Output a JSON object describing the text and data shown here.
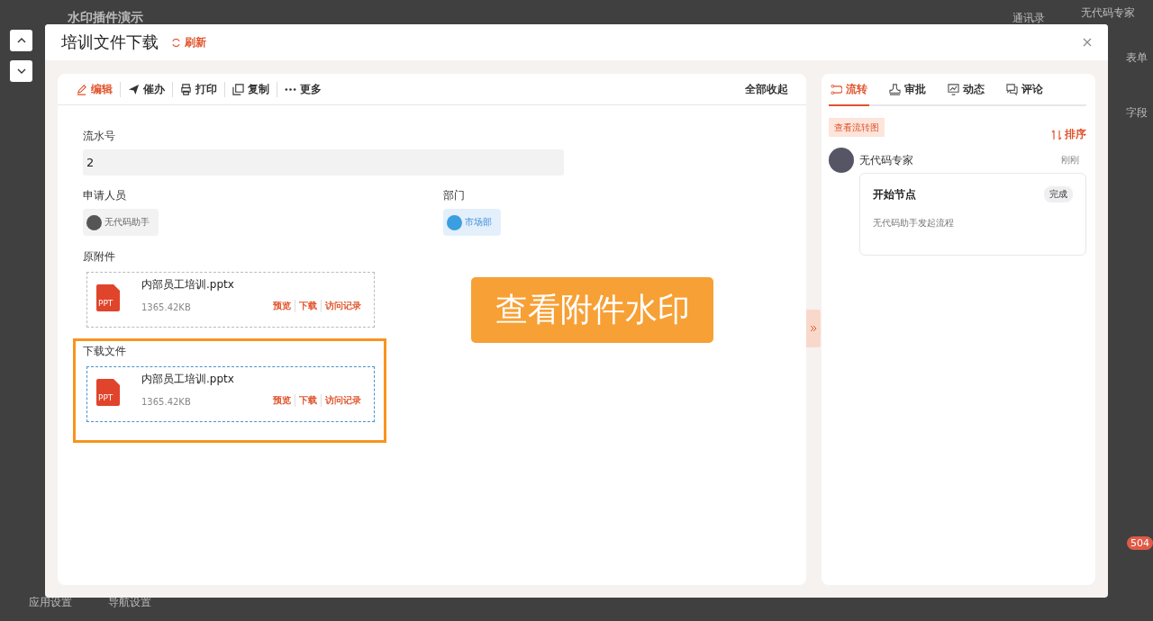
{
  "background": {
    "app_title": "水印插件演示",
    "header_link": "通讯录",
    "user_name": "无代码专家",
    "edge_labels": [
      "表单",
      "字段"
    ],
    "footer_links": [
      "应用设置",
      "导航设置"
    ],
    "badge": "504"
  },
  "modal": {
    "title": "培训文件下载",
    "refresh": "刷新",
    "toolbar": [
      {
        "label": "编辑",
        "kind": "edit"
      },
      {
        "label": "催办",
        "kind": "remind"
      },
      {
        "label": "打印",
        "kind": "print"
      },
      {
        "label": "复制",
        "kind": "copy"
      },
      {
        "label": "更多",
        "kind": "more"
      }
    ],
    "collapse_all": "全部收起",
    "serial": {
      "label": "流水号",
      "value": "2"
    },
    "applicant": {
      "label": "申请人员",
      "name": "无代码助手"
    },
    "department": {
      "label": "部门",
      "name": "市场部"
    },
    "attachments": [
      {
        "label": "原附件",
        "highlighted": false,
        "file": {
          "name": "内部员工培训.pptx",
          "type": "PPT",
          "size": "1365.42KB",
          "actions": [
            "预览",
            "下载",
            "访问记录"
          ]
        }
      },
      {
        "label": "下载文件",
        "highlighted": true,
        "file": {
          "name": "内部员工培训.pptx",
          "type": "PPT",
          "size": "1365.42KB",
          "actions": [
            "预览",
            "下载",
            "访问记录"
          ]
        }
      }
    ],
    "callout": "查看附件水印",
    "side_tabs": [
      {
        "label": "流转",
        "kind": "flow",
        "selected": true
      },
      {
        "label": "审批",
        "kind": "approve",
        "selected": false
      },
      {
        "label": "动态",
        "kind": "activity",
        "selected": false
      },
      {
        "label": "评论",
        "kind": "comment",
        "selected": false
      }
    ],
    "flow_chart_button": "查看流转图",
    "sort": "排序",
    "timeline": [
      {
        "user": "无代码专家",
        "time": "刚刚",
        "node": "开始节点",
        "status": "完成",
        "description": "无代码助手发起流程"
      }
    ]
  }
}
